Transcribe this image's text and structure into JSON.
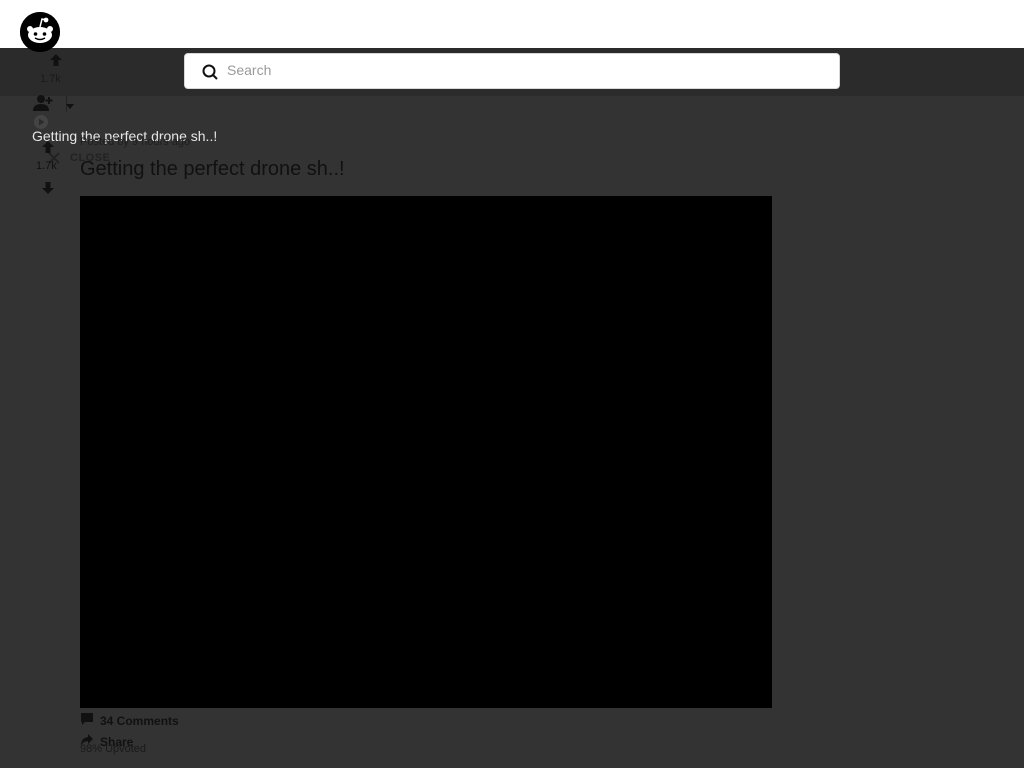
{
  "header": {
    "logo_icon": "reddit-alien-icon",
    "search": {
      "placeholder": "Search",
      "value": "",
      "icon": "search-icon"
    }
  },
  "background_post": {
    "vote_count": "1.7k",
    "upvote_icon": "arrow-up-icon",
    "user_icon": "add-user-icon",
    "caret_icon": "chevron-down-icon",
    "play_icon": "play-icon"
  },
  "post": {
    "overlay_title": "Getting the perfect drone sh..!",
    "posted_by": "Posted by 9 hours ago",
    "close_label": "CLOSE",
    "close_icon": "close-icon",
    "vote_count": "1.7k",
    "title": "Getting the perfect drone sh..!",
    "comments_label": "34 Comments",
    "comments_icon": "comment-icon",
    "share_label": "Share",
    "share_icon": "share-icon",
    "upvoted_label": "98% Upvoted"
  },
  "colors": {
    "page_background": "#333333",
    "header_background": "#ffffff",
    "nav_background": "#2b2b2b",
    "video_background": "#000000"
  }
}
